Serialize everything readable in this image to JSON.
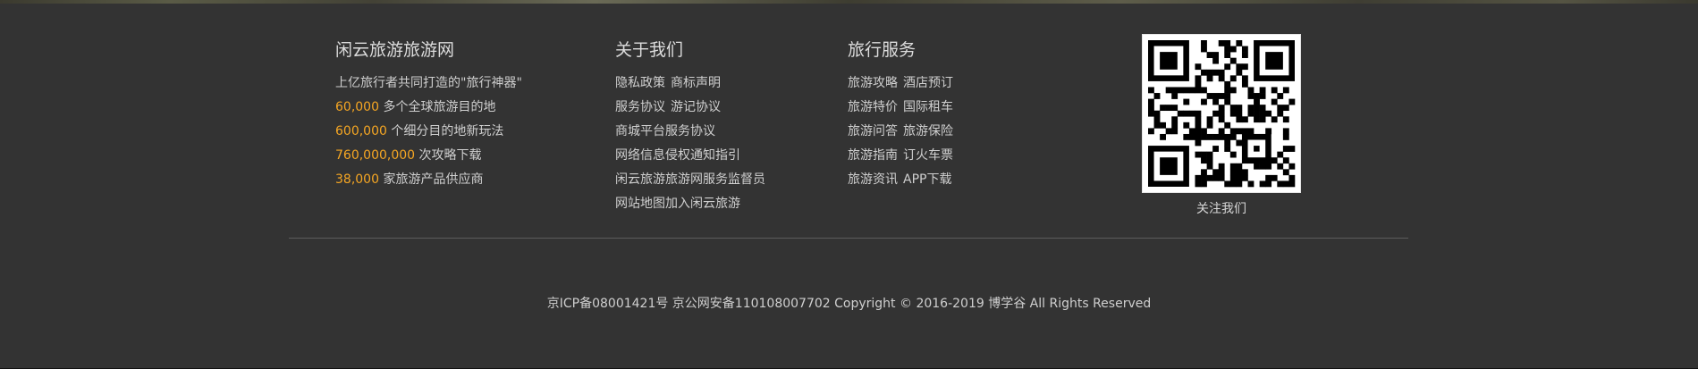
{
  "footer": {
    "brand": {
      "title": "闲云旅游旅游网",
      "tagline": "上亿旅行者共同打造的\"旅行神器\"",
      "stats": [
        {
          "number": "60,000",
          "text": " 多个全球旅游目的地"
        },
        {
          "number": "600,000",
          "text": " 个细分目的地新玩法"
        },
        {
          "number": "760,000,000",
          "text": " 次攻略下载"
        },
        {
          "number": "38,000",
          "text": " 家旅游产品供应商"
        }
      ],
      "number_color": "#f5a623"
    },
    "about": {
      "title": "关于我们",
      "rows": [
        [
          "隐私政策",
          "商标声明"
        ],
        [
          "服务协议",
          "游记协议"
        ],
        [
          "商城平台服务协议"
        ],
        [
          "网络信息侵权通知指引"
        ],
        [
          "闲云旅游旅游网服务监督员"
        ],
        [
          "网站地图加入闲云旅游"
        ]
      ]
    },
    "services": {
      "title": "旅行服务",
      "rows": [
        [
          "旅游攻略",
          "酒店预订"
        ],
        [
          "旅游特价",
          "国际租车"
        ],
        [
          "旅游问答",
          "旅游保险"
        ],
        [
          "旅游指南",
          "订火车票"
        ],
        [
          "旅游资讯",
          "APP下载"
        ]
      ]
    },
    "qr": {
      "caption": "关注我们",
      "icon": "qr-code-icon"
    },
    "copyright": "京ICP备08001421号 京公网安备110108007702 Copyright © 2016-2019 博学谷 All Rights Reserved"
  }
}
